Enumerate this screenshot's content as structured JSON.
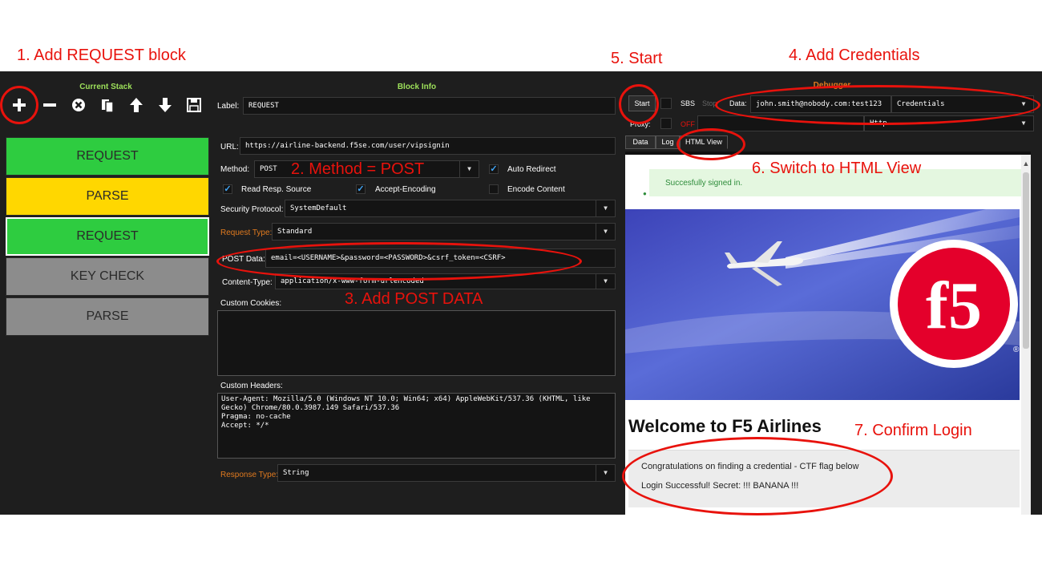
{
  "annotations": {
    "step1": "1. Add REQUEST block",
    "step2": "2. Method = POST",
    "step3": "3. Add POST DATA",
    "step4": "4. Add Credentials",
    "step5": "5. Start",
    "step6": "6. Switch to HTML View",
    "step7": "7. Confirm Login"
  },
  "stack": {
    "title": "Current Stack",
    "toolbar_icons": [
      "plus-icon",
      "minus-icon",
      "remove-circle-icon",
      "copy-icon",
      "arrow-up-icon",
      "arrow-down-icon",
      "save-icon"
    ],
    "items": [
      {
        "label": "REQUEST",
        "color": "#2ecc40"
      },
      {
        "label": "PARSE",
        "color": "#ffd700"
      },
      {
        "label": "REQUEST",
        "color": "#2ecc40"
      },
      {
        "label": "KEY CHECK",
        "color": "#8c8c8c"
      },
      {
        "label": "PARSE",
        "color": "#8c8c8c"
      }
    ]
  },
  "block": {
    "title": "Block Info",
    "label_caption": "Label:",
    "label_value": "REQUEST",
    "url_caption": "URL:",
    "url_value": "https://airline-backend.f5se.com/user/vipsignin",
    "method_caption": "Method:",
    "method_value": "POST",
    "auto_redirect": "Auto Redirect",
    "read_resp_source": "Read Resp. Source",
    "accept_encoding": "Accept-Encoding",
    "encode_content": "Encode Content",
    "security_protocol_caption": "Security Protocol:",
    "security_protocol_value": "SystemDefault",
    "request_type_caption": "Request Type:",
    "request_type_value": "Standard",
    "post_data_caption": "POST Data:",
    "post_data_value": "email=<USERNAME>&password=<PASSWORD>&csrf_token=<CSRF>",
    "content_type_caption": "Content-Type:",
    "content_type_value": "application/x-www-form-urlencoded",
    "custom_cookies_caption": "Custom Cookies:",
    "custom_cookies_value": "",
    "custom_headers_caption": "Custom Headers:",
    "custom_headers_value": "User-Agent: Mozilla/5.0 (Windows NT 10.0; Win64; x64) AppleWebKit/537.36 (KHTML, like\nGecko) Chrome/80.0.3987.149 Safari/537.36\nPragma: no-cache\nAccept: */*",
    "response_type_caption": "Response Type:",
    "response_type_value": "String"
  },
  "debugger": {
    "title": "Debugger",
    "start_button": "Start",
    "sbs_label": "SBS",
    "stop_label": "Stop",
    "data_caption": "Data:",
    "data_value": "john.smith@nobody.com:test123",
    "credentials_value": "Credentials",
    "proxy_label": "Proxy:",
    "proxy_state": "OFF",
    "proxy_type": "Http",
    "tabs": [
      "Data",
      "Log",
      "HTML View"
    ]
  },
  "html_view": {
    "success_message": "Succesfully signed in.",
    "welcome_heading": "Welcome to F5 Airlines",
    "congrats_line": "Congratulations on finding a credential - CTF flag below",
    "secret_line": "Login Successful! Secret: !!! BANANA !!!",
    "logo_text": "f5",
    "registered_mark": "®"
  },
  "colors": {
    "annotation_red": "#e8120c",
    "panel_bg": "#1e1e1e",
    "title_green": "#9de05a",
    "label_orange": "#e07a1f",
    "checkbox_blue": "#42a5f5",
    "f5_red": "#e4002b"
  }
}
